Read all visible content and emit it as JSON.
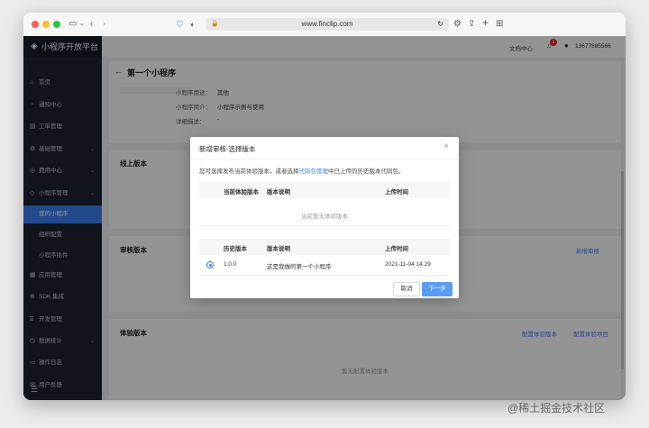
{
  "browser": {
    "url": "www.finclip.com"
  },
  "sidebar": {
    "brand": "小程序开放平台",
    "items": [
      {
        "label": "首页",
        "icon": "home-icon",
        "glyph": "⌂",
        "chevron": false
      },
      {
        "label": "通知中心",
        "icon": "bell-icon",
        "glyph": "◔",
        "chevron": false
      },
      {
        "label": "工单管理",
        "icon": "ticket-icon",
        "glyph": "▤",
        "chevron": false
      },
      {
        "label": "基础管理",
        "icon": "settings-icon",
        "glyph": "⚙",
        "chevron": true
      },
      {
        "label": "费用中心",
        "icon": "coin-icon",
        "glyph": "◎",
        "chevron": true
      },
      {
        "label": "小程序管理",
        "icon": "cube-icon",
        "glyph": "◇",
        "chevron": true
      }
    ],
    "subitems": [
      {
        "label": "我的小程序",
        "active": true
      },
      {
        "label": "组织配置",
        "active": false
      },
      {
        "label": "小程序插件",
        "active": false
      }
    ],
    "items2": [
      {
        "label": "应用管理",
        "icon": "grid-icon",
        "glyph": "▦",
        "chevron": false
      },
      {
        "label": "SDK 集成",
        "icon": "sdk-icon",
        "glyph": "⊕",
        "chevron": false
      },
      {
        "label": "开发管理",
        "icon": "code-icon",
        "glyph": "⌸",
        "chevron": false
      },
      {
        "label": "数据统计",
        "icon": "chart-icon",
        "glyph": "◷",
        "chevron": true
      },
      {
        "label": "操作日志",
        "icon": "log-icon",
        "glyph": "▭",
        "chevron": false
      },
      {
        "label": "用户反馈",
        "icon": "feedback-icon",
        "glyph": "✉",
        "chevron": false
      }
    ],
    "collapse_glyph": "☰"
  },
  "topbar": {
    "docs": "文档中心",
    "badge": "1",
    "user": "13677885566"
  },
  "page": {
    "back": "←",
    "title": "第一个小程序",
    "info": [
      {
        "label": "小程序用途：",
        "value": "其他"
      },
      {
        "label": "小程序简介：",
        "value": "小程序示例与使用"
      },
      {
        "label": "详细描述：",
        "value": "-"
      }
    ],
    "online_title": "线上版本",
    "review_title": "审核版本",
    "review_action": "新增审核",
    "trial_title": "体验版本",
    "trial_action1": "配置体验版本",
    "trial_action2": "配置体验项目",
    "trial_empty": "暂无配置体验版本"
  },
  "modal": {
    "title": "新增审核-选择版本",
    "close": "×",
    "desc_before": "您可选择发布当前体验版本，或者选择",
    "desc_link": "代码包管理",
    "desc_after": "中已上传的历史版本代码包。",
    "current_header": [
      "当前体验版本",
      "版本说明",
      "上传时间"
    ],
    "current_empty": "当前暂无体验版本",
    "history_header": [
      "历史版本",
      "版本说明",
      "上传时间"
    ],
    "history_rows": [
      {
        "version": "1.0.0",
        "desc": "这是我做的第一个小程序",
        "time": "2021-11-04 14:29",
        "selected": true
      }
    ],
    "cancel": "取消",
    "next": "下一步"
  },
  "watermark": "@稀土掘金技术社区",
  "colors": {
    "accent": "#3a7ef0",
    "sidebar": "#1e2433",
    "primary_button": "#5b9cf5",
    "badge": "#f5222d"
  }
}
